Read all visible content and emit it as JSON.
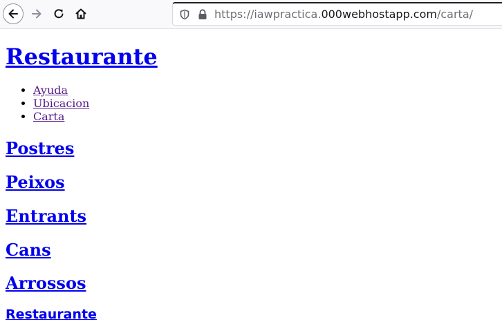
{
  "browser": {
    "url_prefix": "https://iawpractica.",
    "url_host": "000webhostapp.com",
    "url_path": "/carta/"
  },
  "page": {
    "site_title": "Restaurante",
    "menu": [
      {
        "label": "Ayuda"
      },
      {
        "label": "Ubicacion"
      },
      {
        "label": "Carta"
      }
    ],
    "sections": [
      {
        "label": "Postres"
      },
      {
        "label": "Peixos"
      },
      {
        "label": "Entrants"
      },
      {
        "label": "Cans"
      },
      {
        "label": "Arrossos"
      }
    ],
    "footer_title": "Restaurante"
  }
}
